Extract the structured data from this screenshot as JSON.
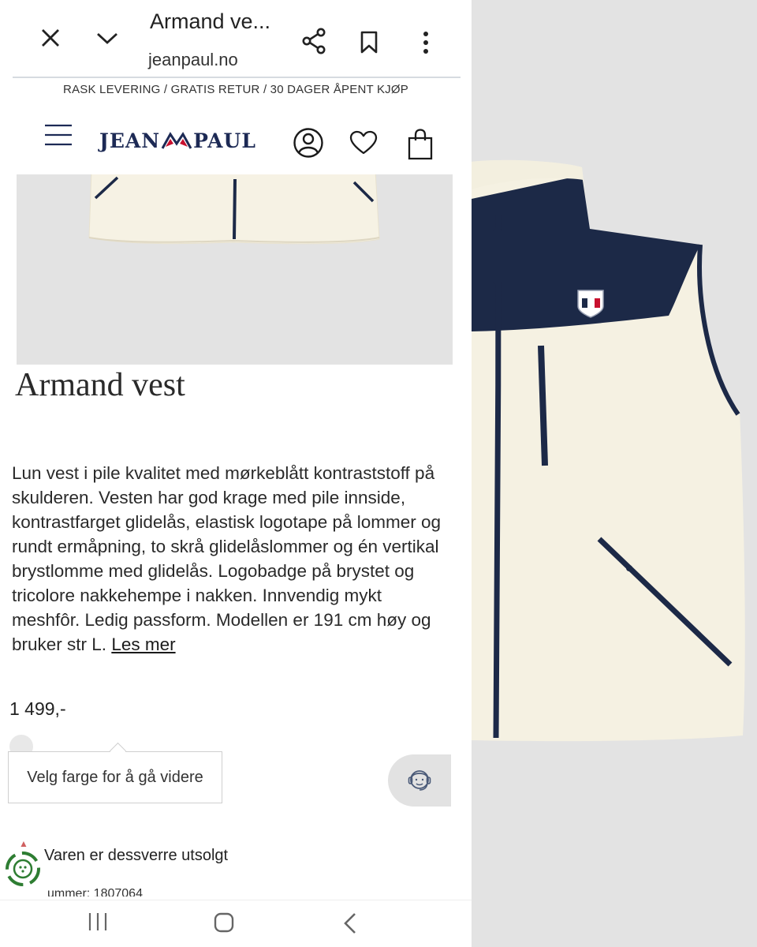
{
  "browser": {
    "tab_title": "Armand ve...",
    "url": "jeanpaul.no",
    "icons": [
      "close-icon",
      "chevron-down-icon",
      "share-icon",
      "bookmark-icon",
      "more-vert-icon"
    ]
  },
  "site": {
    "promo": "RASK LEVERING / GRATIS RETUR / 30 DAGER ÅPENT KJØP",
    "logo_left": "JEAN",
    "logo_right": "PAUL",
    "icons": [
      "menu-icon",
      "account-icon",
      "heart-icon",
      "bag-icon"
    ],
    "colors": {
      "brand_navy": "#1d2a55",
      "flag_red": "#c8102e"
    }
  },
  "product": {
    "title": "Armand vest",
    "description": "Lun vest i pile kvalitet med mørkeblått kontraststoff på skulderen. Vesten har god krage med pile innside, kontrastfarget glidelås, elastisk logotape på lommer og rundt ermåpning, to skrå glidelåslommer og én vertikal brystlomme med glidelås. Logobadge på brystet og tricolore nakkehempe i nakken. Innvendig mykt meshfôr. Ledig passform. Modellen er 191 cm høy og bruker str L.",
    "read_more": "Les mer",
    "price": "1 499,-",
    "color_prompt": "Velg farge for å gå videre",
    "sold_out": "Varen er dessverre utsolgt",
    "article_number": "ummer: 1807064",
    "colors": {
      "cream": "#f4f0e2",
      "navy": "#1c2947"
    }
  },
  "android_nav": {
    "icons": [
      "recents-icon",
      "home-icon",
      "back-icon"
    ]
  }
}
